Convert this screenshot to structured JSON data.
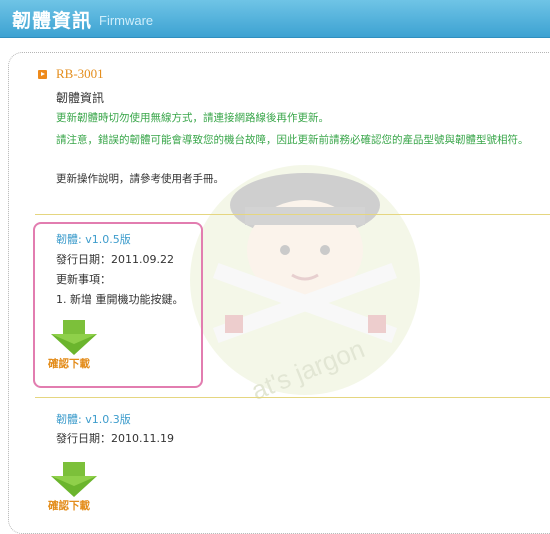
{
  "header": {
    "title": "韌體資訊",
    "subtitle": "Firmware"
  },
  "product": {
    "model": "RB-3001",
    "section_title": "韌體資訊",
    "notice_wired": "更新韌體時切勿使用無線方式，請連接網路線後再作更新。",
    "notice_model": "請注意，錯誤的韌體可能會導致您的機台故障，因此更新前請務必確認您的產品型號與韌體型號相符。",
    "manual_note": "更新操作說明，請參考使用者手冊。"
  },
  "firmware": [
    {
      "version": "韌體: v1.0.5版",
      "release_date": "發行日期：2011.09.22",
      "notes_title": "更新事項：",
      "note": "1. 新增 重開機功能按鍵。",
      "download_label": "確認下載"
    },
    {
      "version": "韌體: v1.0.3版",
      "release_date": "發行日期：2010.11.19",
      "download_label": "確認下載"
    }
  ],
  "watermark_text": "at's jargon",
  "colors": {
    "header": "#3da2d2",
    "accent": "#e48e1d",
    "notice": "#39a64a",
    "highlight": "#e27db0",
    "link": "#3d9ccc"
  },
  "icons": {
    "bullet": "orange-square-arrow-icon",
    "download": "green-down-arrow-icon"
  }
}
